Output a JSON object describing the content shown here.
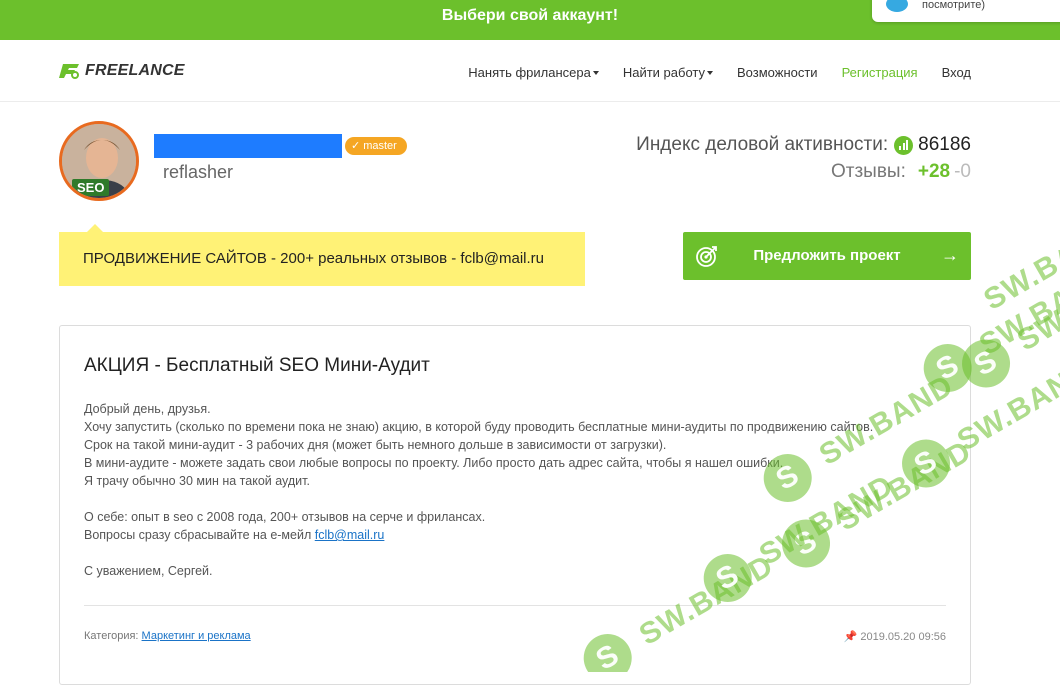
{
  "promo": {
    "text": "Выбери свой аккаунт!",
    "popup_text": "посмотрите)"
  },
  "header": {
    "logo_text": "FREELANCE",
    "nav": [
      {
        "label": "Нанять фрилансера",
        "dropdown": true
      },
      {
        "label": "Найти работу",
        "dropdown": true
      },
      {
        "label": "Возможности",
        "dropdown": false
      },
      {
        "label": "Регистрация",
        "dropdown": false,
        "active": true
      },
      {
        "label": "Вход",
        "dropdown": false
      }
    ]
  },
  "profile": {
    "avatar_badge": "SEO",
    "master_badge": "master",
    "username": "reflasher",
    "activity_label": "Индекс деловой активности:",
    "activity_value": "86186",
    "reviews_label": "Отзывы:",
    "reviews_positive": "+28",
    "reviews_negative": "-0",
    "slogan": "ПРОДВИЖЕНИЕ САЙТОВ - 200+ реальных отзывов - fclb@mail.ru",
    "propose_button": "Предложить проект"
  },
  "card": {
    "title": "АКЦИЯ - Бесплатный SEO Мини-Аудит",
    "lines": [
      "Добрый день, друзья.",
      "Хочу запустить (сколько по времени пока не знаю) акцию, в которой буду проводить бесплатные мини-аудиты по продвижению сайтов.",
      "Срок на такой мини-аудит - 3 рабочих дня (может быть немного дольше в зависимости от загрузки).",
      "В мини-аудите - можете задать свои любые вопросы по проекту. Либо просто дать адрес сайта, чтобы я нашел ошибки.",
      "Я трачу обычно 30 мин на такой аудит.",
      "О себе: опыт в seo с 2008 года, 200+ отзывов на серче и фрилансах.",
      "Вопросы сразу сбрасывайте на е-мейл ",
      "С уважением, Сергей."
    ],
    "email_link": "fclb@mail.ru",
    "category_label": "Категория: ",
    "category_link": "Маркетинг и реклама",
    "date": "2019.05.20 09:56"
  },
  "watermark": {
    "text": "SW.BAND",
    "logo_letter": "S"
  },
  "colors": {
    "brand_green": "#6cc02c",
    "slogan_yellow": "#fff276",
    "master_orange": "#f5a623",
    "link_blue": "#1a73c7",
    "redaction_blue": "#1e7cff"
  }
}
